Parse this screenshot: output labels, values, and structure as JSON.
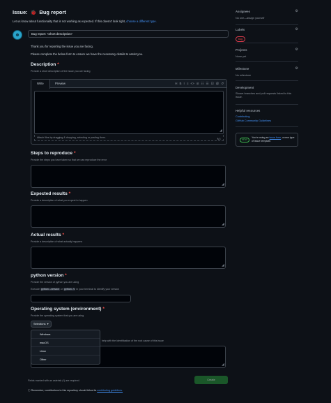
{
  "header": {
    "prefix": "Issue:",
    "template_name": "Bug report"
  },
  "intro": {
    "text": "Let us know about functionality that is not working as expected. If this doesn't look right,",
    "link": "choose a different type."
  },
  "title_input": {
    "value": "Bug report: <short description>"
  },
  "thanks": "Thank you for reporting the issue you are facing.",
  "please": "Please complete the below form to ensure we have the necessary details to assist you.",
  "description": {
    "label": "Description",
    "hint": "Provide a short description of the issue you are facing",
    "tab_write": "Write",
    "tab_preview": "Preview",
    "toolbar_icons": [
      "H",
      "B",
      "I",
      "≡",
      "<>",
      "⊘",
      "☷",
      "☰",
      "☑",
      "@",
      "↺"
    ],
    "attach": "Attach files by dragging & dropping, selecting or pasting them.",
    "markdown_icon": "M↓"
  },
  "steps": {
    "label": "Steps to reproduce",
    "hint": "Provide the steps you have taken so that we can reproduce the error"
  },
  "expected": {
    "label": "Expected results",
    "hint": "Provide a description of what you expect to happen"
  },
  "actual": {
    "label": "Actual results",
    "hint": "Provide a description of what actually happens"
  },
  "python": {
    "label": "python version",
    "hint": "Provide the version of python you are using",
    "run_prefix": "Execute",
    "code1": "python --version",
    "or": "or",
    "code2": "python -V",
    "run_suffix": "in your terminal to identify your version"
  },
  "os": {
    "label": "Operating system (environment)",
    "hint": "Provide the operating system that you are using",
    "select_value": "Selections",
    "options": [
      "Windows",
      "macOS",
      "Linux",
      "Other"
    ]
  },
  "additional": {
    "hint": "help with the identification of the root cause of this issue"
  },
  "footer": {
    "required_note": "Fields marked with an asterisk (*) are required.",
    "submit": "Create",
    "contrib_prefix": "Remember, contributions to this repository should follow its",
    "contrib_link": "contributing guidelines."
  },
  "sidebar": {
    "assignees": {
      "title": "Assignees",
      "value": "No one—assign yourself"
    },
    "labels": {
      "title": "Labels",
      "bug": "bug"
    },
    "projects": {
      "title": "Projects",
      "value": "None yet"
    },
    "milestone": {
      "title": "Milestone",
      "value": "No milestone"
    },
    "development": {
      "title": "Development",
      "value": "Shows branches and pull requests linked to this issue."
    },
    "helpful": {
      "title": "Helpful resources",
      "links": [
        "Contributing",
        "GitHub Community Guidelines"
      ]
    },
    "info": {
      "pill": "NEW",
      "prefix": "You're using an",
      "link": "issue form",
      "suffix": ", a new type of issue template."
    }
  },
  "colors": {
    "accent": "#4493f8",
    "danger": "#f85149",
    "success": "#238636",
    "bg": "#0d1117"
  }
}
